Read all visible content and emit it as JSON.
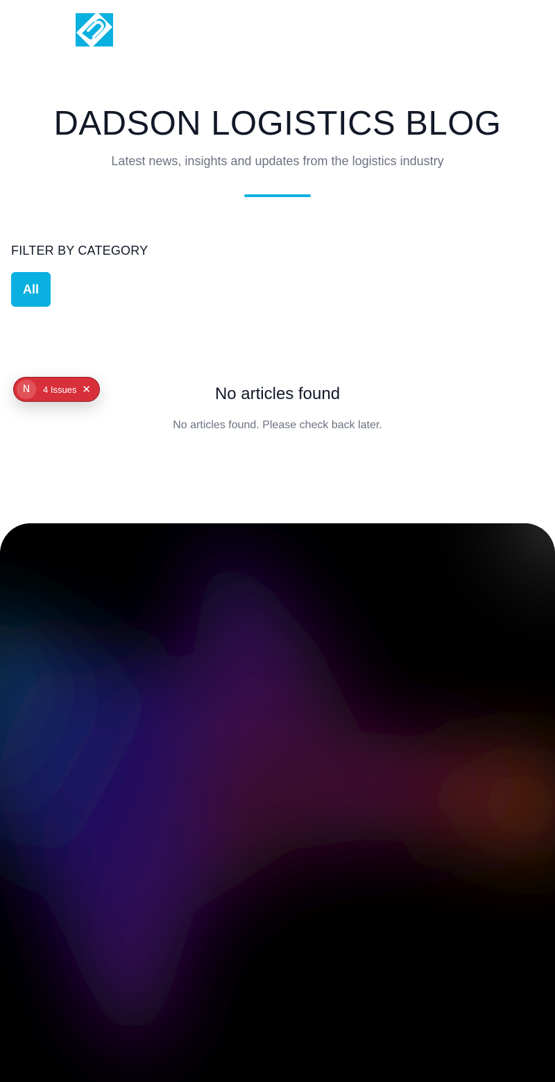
{
  "logo": {
    "icon": "brand-s-logo",
    "color": "#0ab0e0"
  },
  "hero": {
    "title": "DADSON LOGISTICS BLOG",
    "subtitle": "Latest news, insights and updates from the logistics industry",
    "accent": "#0ab0e0"
  },
  "filter": {
    "heading": "FILTER BY CATEGORY",
    "categories": [
      "All"
    ],
    "selected": "All"
  },
  "empty": {
    "title": "No articles found",
    "message": "No articles found. Please check back later."
  },
  "dev_overlay": {
    "badge": "N",
    "issues_label": "4 Issues",
    "close_icon": "close-icon",
    "color": "#d8303a"
  },
  "footer": {
    "background": "#000000",
    "gradient_colors": [
      "#0a4a5a",
      "#1a1466",
      "#3c0a5a",
      "#4a1028",
      "#6a2a08"
    ]
  }
}
